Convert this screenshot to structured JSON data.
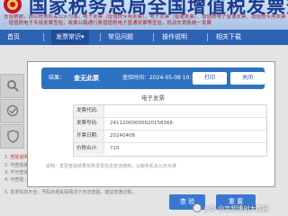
{
  "header": {
    "title": "国家税务总局全国增值税发票查验平台",
    "subtitle_line1": "查验数据，请以税务机关公示为准。电子发票（增值税专用发票）、电子发票（普通发票）、增值税电子普通发票、增值税专用发票（电子）查验",
    "subtitle_line2": "、增值税电子专用发票查验，收费公路通行费增值税电子普通发票等查验，机动车销售统一发票"
  },
  "nav": {
    "items": [
      "首页",
      "发票常识",
      "常见问题",
      "操作说明",
      "相关下载"
    ],
    "active_index": 1,
    "dropdown_marker": "▾"
  },
  "page": {
    "note_red": "1. 查验说明：",
    "note_grey_1": "2. 可查验使用...",
    "note_grey_2": "3. 不可查验...",
    "note_grey_3": "4. 可查验...",
    "note_grey_4": "5. 发票信息不全、号码出现乱码情况下无法查验，建议您通过税...",
    "bottom_buttons": [
      "查 验",
      "重 置"
    ]
  },
  "result_dialog": {
    "result_label": "结果：",
    "result_value": "查无此票",
    "query_time_label": "查验时间：",
    "query_time_value": "2024-05-08 10:13:59",
    "print_button": "打印",
    "close_button": "关闭",
    "invoice_type": "电子发票",
    "fields": [
      {
        "label": "发票代码:",
        "value": ""
      },
      {
        "label": "发票号码:",
        "value": "24112000000020158366"
      },
      {
        "label": "开票日期:",
        "value": "20240408"
      },
      {
        "label": "价税合计:",
        "value": "720"
      }
    ],
    "note": "说明：发票查验结果仅供发票信息查询使用，以税务机关公示为准"
  },
  "watermark": {
    "text": "头条 @京超博创大数据"
  },
  "colors": {
    "nav_blue": "#2e63b4",
    "dialog_header_blue": "#2e72c2",
    "title_blue": "#1a3a8e",
    "button_blue": "#3a78d0"
  }
}
